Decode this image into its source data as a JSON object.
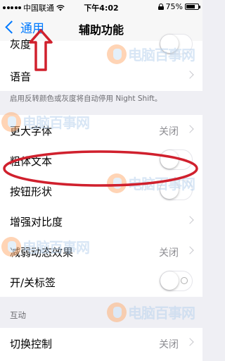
{
  "status_bar": {
    "carrier": "中国联通",
    "time": "下午4:02",
    "battery": "75%",
    "battery_level": 0.75
  },
  "nav": {
    "back_label": "通用",
    "title": "辅助功能"
  },
  "rows": [
    {
      "label": "灰度",
      "control": "toggle"
    },
    {
      "label": "语音",
      "control": "chevron"
    }
  ],
  "footer": "启用反转颜色或灰度将自动停用 Night Shift。",
  "rows2": [
    {
      "label": "更大字体",
      "value": "关闭",
      "control": "chevron"
    },
    {
      "label": "粗体文本",
      "control": "toggle"
    },
    {
      "label": "按钮形状",
      "control": "toggle"
    },
    {
      "label": "增强对比度",
      "control": "chevron"
    },
    {
      "label": "减弱动态效果",
      "value": "关闭",
      "control": "chevron"
    },
    {
      "label": "开/关标签",
      "control": "toggle"
    }
  ],
  "section2": {
    "header": "互动"
  },
  "rows3": [
    {
      "label": "切换控制",
      "value": "关闭",
      "control": "chevron"
    }
  ],
  "watermark": {
    "text": "电脑百事网"
  },
  "annotation_color": "#d0202d",
  "accent_color": "#007aff"
}
